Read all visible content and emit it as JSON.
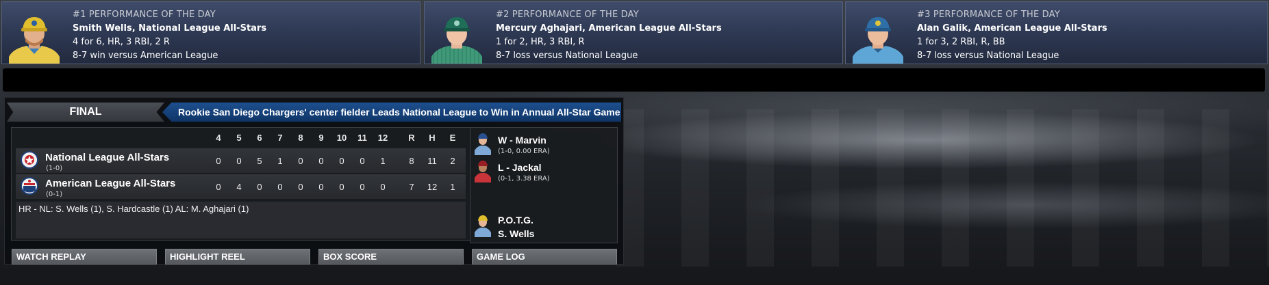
{
  "performances": [
    {
      "rank_label": "#1 PERFORMANCE OF THE DAY",
      "name_line": "Smith Wells, National League All-Stars",
      "stat_line": "4 for 6, HR, 3 RBI, 2 R",
      "result_line": "8-7 win versus American League",
      "avatar": "player-portrait-yellow-cap"
    },
    {
      "rank_label": "#2 PERFORMANCE OF THE DAY",
      "name_line": "Mercury Aghajari, American League All-Stars",
      "stat_line": "1 for 2, HR, 3 RBI, R",
      "result_line": "8-7 loss versus National League",
      "avatar": "player-portrait-teal-cap"
    },
    {
      "rank_label": "#3 PERFORMANCE OF THE DAY",
      "name_line": "Alan Galik, American League All-Stars",
      "stat_line": "1 for 3, 2 RBI, R, BB",
      "result_line": "8-7 loss versus National League",
      "avatar": "player-portrait-blue-cap"
    }
  ],
  "game": {
    "status": "FINAL",
    "headline": "Rookie San Diego Chargers' center fielder Leads National League to Win in Annual All-Star Game",
    "innings": [
      "4",
      "5",
      "6",
      "7",
      "8",
      "9",
      "10",
      "11",
      "12"
    ],
    "totals_headers": [
      "R",
      "H",
      "E"
    ],
    "teams": [
      {
        "name": "National League All-Stars",
        "record": "(1-0)",
        "innings": [
          "0",
          "0",
          "5",
          "1",
          "0",
          "0",
          "0",
          "0",
          "1"
        ],
        "totals": [
          "8",
          "11",
          "2"
        ],
        "logo": "national-league-logo"
      },
      {
        "name": "American League All-Stars",
        "record": "(0-1)",
        "innings": [
          "0",
          "4",
          "0",
          "0",
          "0",
          "0",
          "0",
          "0",
          "0"
        ],
        "totals": [
          "7",
          "12",
          "1"
        ],
        "logo": "american-league-logo"
      }
    ],
    "home_runs": "HR - NL: S. Wells (1), S. Hardcastle (1)  AL: M. Aghajari (1)"
  },
  "pitchers": {
    "win_name": "W - Marvin",
    "win_stats": "(1-0, 0.00 ERA)",
    "loss_name": "L - Jackal",
    "loss_stats": "(0-1, 3.38 ERA)",
    "potg_label": "P.O.T.G.",
    "potg_name": "S. Wells"
  },
  "buttons": {
    "watch_replay": "WATCH REPLAY",
    "highlight_reel": "HIGHLIGHT REEL",
    "box_score": "BOX SCORE",
    "game_log": "GAME LOG"
  },
  "colors": {
    "headline_blue": "#0f3567",
    "card_navy": "#2f3a55",
    "button_gray": "#5f6267"
  }
}
